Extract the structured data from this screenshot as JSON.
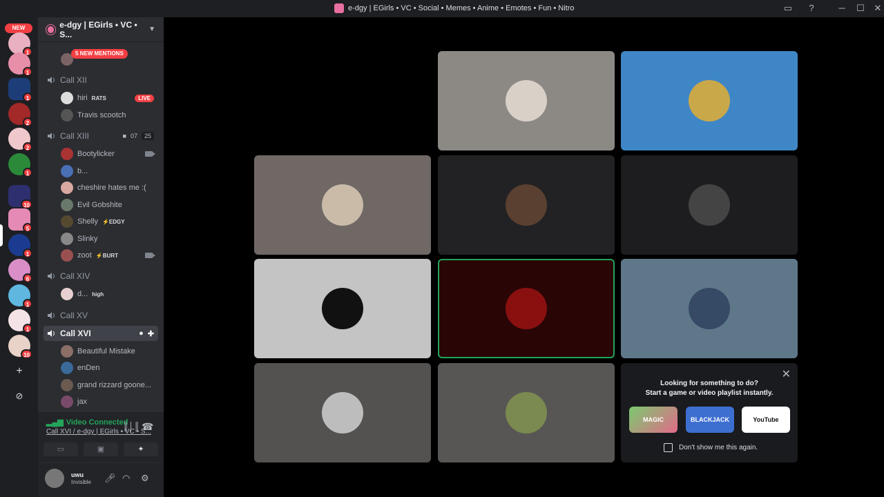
{
  "window": {
    "title": "e-dgy | EGirls • VC • Social • Memes • Anime • Emotes • Fun • Nitro",
    "controls": [
      "▭",
      "?",
      "─",
      "☐",
      "✕"
    ]
  },
  "guilds": {
    "new_label": "NEW",
    "badges": [
      "1",
      "1",
      "1",
      "2",
      "2",
      "1",
      "10",
      "5",
      "1",
      "6",
      "1",
      "1",
      "10"
    ],
    "add_label": "+",
    "explore_label": "⊘"
  },
  "server": {
    "name": "e-dgy | EGirls • VC • S...",
    "mentions_label": "5 NEW MENTIONS"
  },
  "channels": {
    "call12": {
      "name": "Call XII",
      "members": [
        {
          "name": "hiri",
          "tag": "RATS",
          "live": "LIVE"
        },
        {
          "name": "Travis scootch"
        }
      ]
    },
    "call13": {
      "name": "Call XIII",
      "video_count": "07",
      "limit": "25",
      "members": [
        {
          "name": "Bootylicker"
        },
        {
          "name": "b..."
        },
        {
          "name": "cheshire hates me :("
        },
        {
          "name": "Evil Gobshite"
        },
        {
          "name": "Shelly",
          "tag": "⚡EDGY"
        },
        {
          "name": "Slinky"
        },
        {
          "name": "zoot",
          "tag": "⚡BURT"
        }
      ]
    },
    "call14": {
      "name": "Call XIV",
      "members": [
        {
          "name": "d...",
          "tag": "high"
        }
      ]
    },
    "call15": {
      "name": "Call XV"
    },
    "call16": {
      "name": "Call XVI",
      "members": [
        {
          "name": "Beautiful Mistake"
        },
        {
          "name": "enDen"
        },
        {
          "name": "grand rizzard goone..."
        },
        {
          "name": "jax"
        }
      ]
    }
  },
  "voice": {
    "status": "Video Connected",
    "location": "Call XVI / e-dgy | EGirls • VC • S..."
  },
  "user": {
    "name": "uwu",
    "status": "Invisible"
  },
  "activity": {
    "close_label": "✕",
    "line1": "Looking for something to do?",
    "line2": "Start a game or video playlist instantly.",
    "cards": [
      "MAGIC",
      "BLACKJACK",
      "YouTube"
    ],
    "dont_show": "Don't show me this again."
  },
  "tiles": {
    "colors": [
      "#8c8985",
      "#3f86c6",
      "#6f6865",
      "#222224",
      "#1d1d20",
      "#c4c4c4",
      "#2a0506",
      "#5f7889",
      "#535250",
      "#585654"
    ],
    "avatar_colors": [
      "#d9d0c8",
      "#c9a84a",
      "#c9bba8",
      "#5a4030",
      "#444",
      "#111",
      "#8a1010",
      "#364a66",
      "#bdbdbd",
      "#7a8a50"
    ]
  }
}
